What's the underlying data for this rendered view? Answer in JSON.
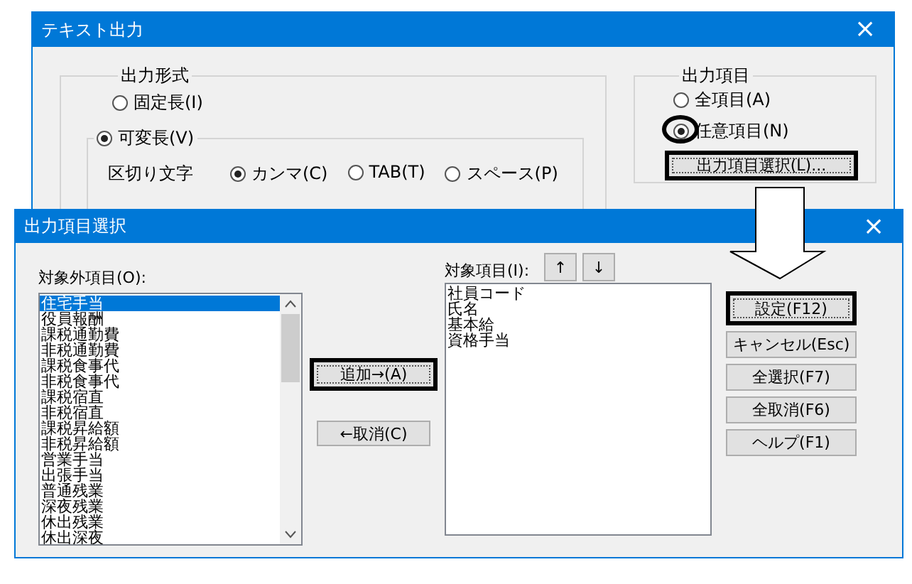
{
  "main_window": {
    "title": "テキスト出力",
    "close": "×",
    "output_format": {
      "label": "出力形式",
      "options": [
        {
          "label": "固定長(I)",
          "selected": false
        },
        {
          "label": "可変長(V)",
          "selected": true
        }
      ],
      "delimiter": {
        "label": "区切り文字",
        "options": [
          {
            "label": "カンマ(C)",
            "selected": true
          },
          {
            "label": "TAB(T)",
            "selected": false
          },
          {
            "label": "スペース(P)",
            "selected": false
          }
        ]
      }
    },
    "output_items": {
      "label": "出力項目",
      "options": [
        {
          "label": "全項目(A)",
          "selected": false,
          "circled": false
        },
        {
          "label": "任意項目(N)",
          "selected": true,
          "circled": true
        }
      ],
      "select_button": {
        "label": "出力項目選択(L)...",
        "emphasized": true
      }
    }
  },
  "dialog": {
    "title": "出力項目選択",
    "close": "×",
    "excluded": {
      "label": "対象外項目(O):",
      "items": [
        {
          "label": "住宅手当",
          "selected": true
        },
        {
          "label": "役員報酬",
          "selected": false
        },
        {
          "label": "課税通勤費",
          "selected": false
        },
        {
          "label": "非税通勤費",
          "selected": false
        },
        {
          "label": "課税食事代",
          "selected": false
        },
        {
          "label": "非税食事代",
          "selected": false
        },
        {
          "label": "課税宿直",
          "selected": false
        },
        {
          "label": "非税宿直",
          "selected": false
        },
        {
          "label": "課税昇給額",
          "selected": false
        },
        {
          "label": "非税昇給額",
          "selected": false
        },
        {
          "label": "営業手当",
          "selected": false
        },
        {
          "label": "出張手当",
          "selected": false
        },
        {
          "label": "普通残業",
          "selected": false
        },
        {
          "label": "深夜残業",
          "selected": false
        },
        {
          "label": "休出残業",
          "selected": false
        },
        {
          "label": "休出深夜",
          "selected": false
        }
      ]
    },
    "add_button": {
      "label": "追加→(A)",
      "emphasized": true
    },
    "remove_button": {
      "label": "←取消(C)",
      "emphasized": false
    },
    "included": {
      "label": "対象項目(I):",
      "up": "↑",
      "down": "↓",
      "items": [
        {
          "label": "社員コード",
          "selected": false
        },
        {
          "label": "氏名",
          "selected": false
        },
        {
          "label": "基本給",
          "selected": false
        },
        {
          "label": "資格手当",
          "selected": false
        }
      ]
    },
    "buttons": [
      {
        "label": "設定(F12)",
        "emphasized": true
      },
      {
        "label": "キャンセル(Esc)",
        "emphasized": false
      },
      {
        "label": "全選択(F7)",
        "emphasized": false
      },
      {
        "label": "全取消(F6)",
        "emphasized": false
      },
      {
        "label": "ヘルプ(F1)",
        "emphasized": false
      }
    ]
  }
}
